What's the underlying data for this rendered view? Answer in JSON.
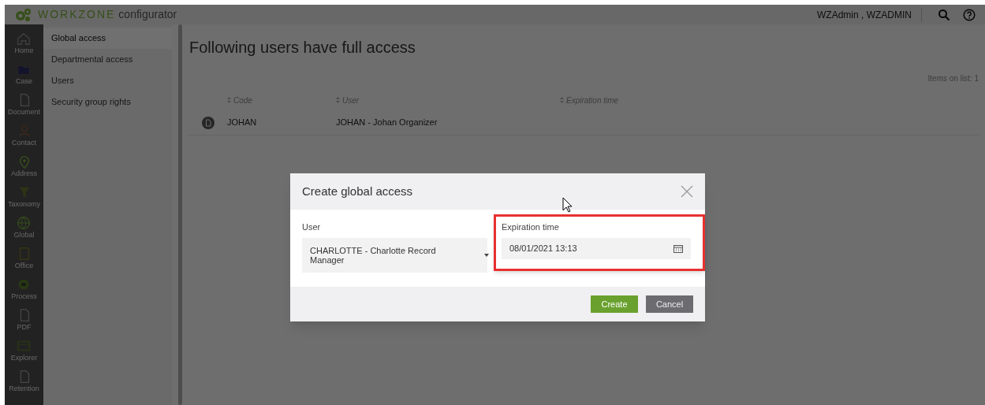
{
  "header": {
    "logo_brand": "WORKZONE",
    "logo_product": "configurator",
    "user": "WZAdmin , WZADMIN"
  },
  "rail": [
    {
      "label": "Home"
    },
    {
      "label": "Case"
    },
    {
      "label": "Document"
    },
    {
      "label": "Contact"
    },
    {
      "label": "Address"
    },
    {
      "label": "Taxonomy"
    },
    {
      "label": "Global"
    },
    {
      "label": "Office"
    },
    {
      "label": "Process"
    },
    {
      "label": "PDF"
    },
    {
      "label": "Explorer"
    },
    {
      "label": "Retention"
    }
  ],
  "submenu": [
    {
      "label": "Global access",
      "selected": true
    },
    {
      "label": "Departmental access",
      "selected": false
    },
    {
      "label": "Users",
      "selected": false
    },
    {
      "label": "Security group rights",
      "selected": false
    }
  ],
  "page": {
    "title": "Following users have full access",
    "items_count": "Items on list: 1",
    "columns": [
      "Code",
      "User",
      "Expiration time"
    ],
    "rows": [
      [
        "JOHAN",
        "JOHAN - Johan Organizer",
        ""
      ]
    ]
  },
  "dialog": {
    "title": "Create global access",
    "fields": [
      {
        "kind": "select",
        "label": "User",
        "value": "CHARLOTTE - Charlotte Record Manager",
        "highlighted": false
      },
      {
        "kind": "date",
        "label": "Expiration time",
        "value": "08/01/2021 13:13",
        "highlighted": true
      }
    ],
    "buttons": [
      {
        "label": "Create",
        "kind": "primary"
      },
      {
        "label": "Cancel",
        "kind": "secondary"
      }
    ]
  }
}
